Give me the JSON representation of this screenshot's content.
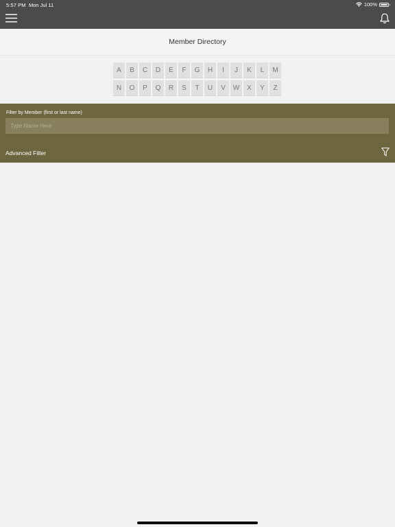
{
  "status_bar": {
    "time": "5:57 PM",
    "date": "Mon Jul 11",
    "battery": "100%"
  },
  "nav": {
    "menu_icon": "hamburger-menu-icon",
    "bell_icon": "bell-icon"
  },
  "title": "Member Directory",
  "alphabet": {
    "row1": [
      "A",
      "B",
      "C",
      "D",
      "E",
      "F",
      "G",
      "H",
      "I",
      "J",
      "K",
      "L",
      "M"
    ],
    "row2": [
      "N",
      "O",
      "P",
      "Q",
      "R",
      "S",
      "T",
      "U",
      "V",
      "W",
      "X",
      "Y",
      "Z"
    ]
  },
  "filter": {
    "label": "Filter by Member (first or last name)",
    "placeholder": "Type Name Here",
    "value": "",
    "advanced_label": "Advanced Filter",
    "filter_icon": "funnel-icon"
  },
  "colors": {
    "topbar": "#4b4b4b",
    "filter_panel": "#6d6540",
    "input_bg": "#887f5f",
    "background": "#f2f2f2"
  }
}
